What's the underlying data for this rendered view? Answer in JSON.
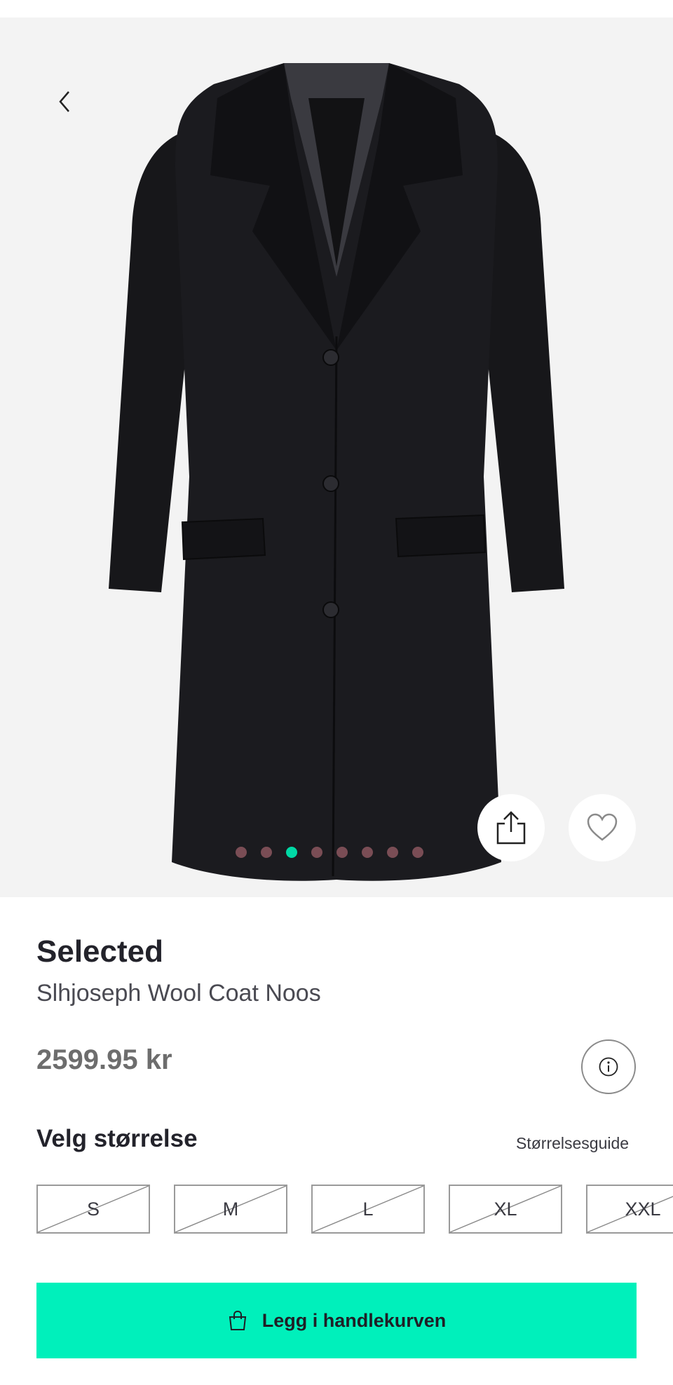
{
  "product": {
    "brand": "Selected",
    "name": "Slhjoseph Wool Coat Noos",
    "price": "2599.95 kr"
  },
  "gallery": {
    "image_count": 8,
    "active_index": 2,
    "accent_color": "#00d9a5"
  },
  "sizes": {
    "title": "Velg størrelse",
    "guide_label": "Størrelsesguide",
    "options": [
      {
        "label": "S",
        "available": false
      },
      {
        "label": "M",
        "available": false
      },
      {
        "label": "L",
        "available": false
      },
      {
        "label": "XL",
        "available": false
      },
      {
        "label": "XXL",
        "available": false
      }
    ]
  },
  "cart": {
    "label": "Legg i handlekurven",
    "button_color": "#00f0bb"
  },
  "icons": {
    "back": "chevron-left-icon",
    "share": "share-icon",
    "favorite": "heart-icon",
    "info": "info-icon",
    "cart": "shopping-bag-icon"
  }
}
